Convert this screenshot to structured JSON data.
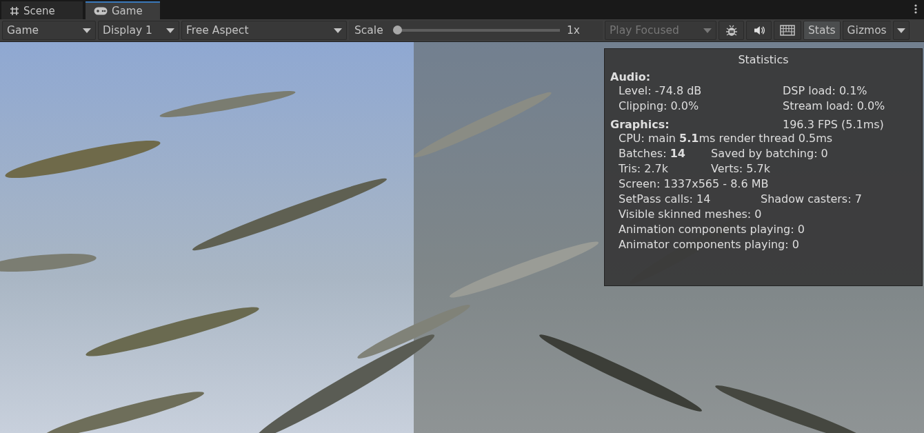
{
  "tabs": [
    {
      "label": "Scene",
      "kind": "scene",
      "selected": false
    },
    {
      "label": "Game",
      "kind": "game",
      "selected": true
    }
  ],
  "toolbar": {
    "view_menu": "Game",
    "display": "Display 1",
    "aspect": "Free Aspect",
    "scale": {
      "label": "Scale",
      "level": 0,
      "reading": "1x"
    },
    "play_mode": {
      "label": "Play Focused",
      "disabled": true
    },
    "stats": {
      "label": "Stats",
      "on": true
    },
    "gizmos": "Gizmos"
  },
  "statistics": {
    "title": "Statistics",
    "sections": [
      {
        "heading": "Audio:",
        "rows": [
          {
            "kind": "audio",
            "cells": [
              "Level: -74.8 dB",
              "DSP load: 0.1%"
            ]
          },
          {
            "kind": "audio",
            "cells": [
              "Clipping: 0.0%",
              "Stream load: 0.0%"
            ]
          }
        ]
      },
      {
        "heading": "Graphics:",
        "aside": "196.3 FPS (5.1ms)",
        "rows": [
          {
            "kind": "single",
            "cells": [
              "CPU: main **5.1**ms  render thread 0.5ms"
            ]
          },
          {
            "kind": "pair",
            "cells": [
              "Batches: **14**",
              "Saved by batching: 0"
            ]
          },
          {
            "kind": "pair",
            "cells": [
              "Tris: 2.7k",
              "Verts: 5.7k"
            ]
          },
          {
            "kind": "single",
            "cells": [
              "Screen: 1337x565 - 8.6 MB"
            ]
          },
          {
            "kind": "wide",
            "cells": [
              "SetPass calls: 14",
              "Shadow casters: 7"
            ]
          },
          {
            "kind": "single",
            "cells": [
              "Visible skinned meshes: 0"
            ]
          },
          {
            "kind": "single",
            "cells": [
              "Animation components playing: 0"
            ]
          },
          {
            "kind": "single",
            "cells": [
              "Animator components playing: 0"
            ]
          }
        ]
      }
    ]
  }
}
